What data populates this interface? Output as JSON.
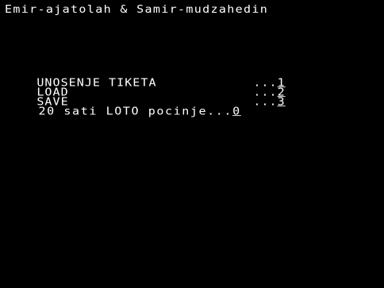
{
  "screen": {
    "title": "Emir-ajatolah & Samir-mudzahedin",
    "menu": [
      {
        "label": "UNOSENJE TIKETA",
        "dots": "...",
        "key": "1"
      },
      {
        "label": "LOAD",
        "dots": "...",
        "key": "2"
      },
      {
        "label": "SAVE",
        "dots": "...",
        "key": "3"
      },
      {
        "label": "20 sati LOTO pocinje",
        "dots": "...",
        "key": "0"
      }
    ]
  },
  "colors": {
    "background": "#000000",
    "text": "#ffffff"
  }
}
